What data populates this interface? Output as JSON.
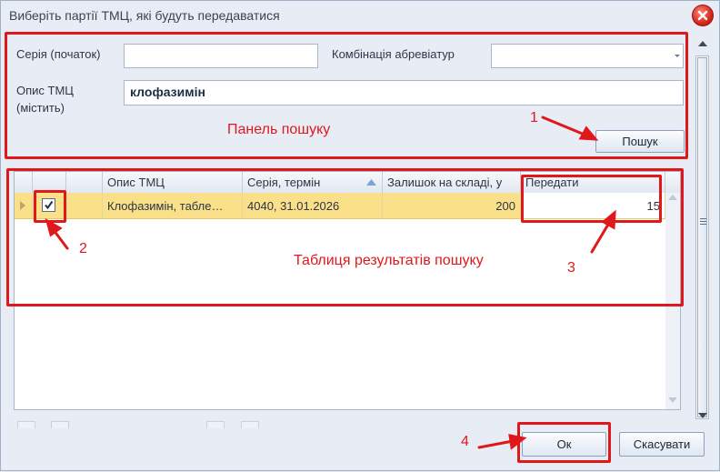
{
  "window": {
    "title": "Виберіть партії ТМЦ, які будуть передаватися"
  },
  "search": {
    "series_label": "Серія (початок)",
    "series_value": "",
    "combo_label": "Комбінація абревіатур",
    "combo_value": "",
    "desc_label_line1": "Опис ТМЦ",
    "desc_label_line2": "(містить)",
    "desc_value": "клофазимін",
    "search_button": "Пошук"
  },
  "table": {
    "columns": [
      "",
      "",
      "",
      "Опис ТМЦ",
      "Серія, термін",
      "Залишок на складі, у",
      "Передати"
    ],
    "rows": [
      {
        "checked": true,
        "desc": "Клофазимін, табле…",
        "series": "4040, 31.01.2026",
        "stock": "200",
        "transfer": "15"
      }
    ]
  },
  "annotations": {
    "search_panel": "Панель пошуку",
    "results_table": "Таблиця результатів пошуку",
    "n1": "1",
    "n2": "2",
    "n3": "3",
    "n4": "4"
  },
  "footer": {
    "ok_button": "Ок",
    "cancel_button": "Скасувати"
  },
  "colors": {
    "highlight": "#e0181c",
    "selected_row": "#fbe08a"
  },
  "icons": {
    "close": "close-icon",
    "sort": "sort-asc-icon",
    "check": "check-icon"
  }
}
